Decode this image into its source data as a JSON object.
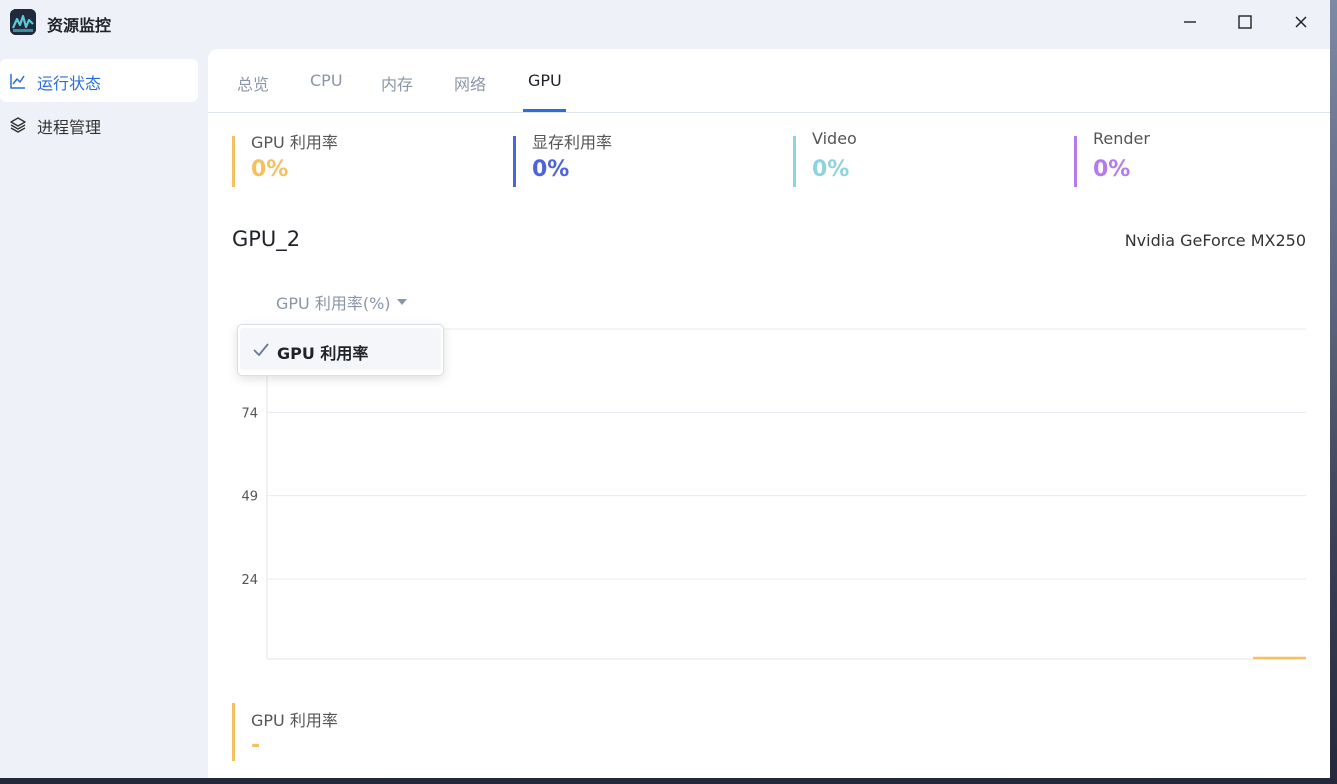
{
  "window": {
    "title": "资源监控",
    "controls": [
      "minimize-icon",
      "maximize-icon",
      "close-icon"
    ]
  },
  "sidebar": {
    "items": [
      {
        "label": "运行状态",
        "icon": "line-chart-icon",
        "active": true
      },
      {
        "label": "进程管理",
        "icon": "layers-icon",
        "active": false
      }
    ]
  },
  "tabs": [
    {
      "label": "总览"
    },
    {
      "label": "CPU"
    },
    {
      "label": "内存"
    },
    {
      "label": "网络"
    },
    {
      "label": "GPU",
      "active": true
    }
  ],
  "stats": [
    {
      "label": "GPU 利用率",
      "value": "0%",
      "color": "#f5c160"
    },
    {
      "label": "显存利用率",
      "value": "0%",
      "color": "#4e65d9"
    },
    {
      "label": "Video",
      "value": "0%",
      "color": "#8fd3df"
    },
    {
      "label": "Render",
      "value": "0%",
      "color": "#b57bea"
    }
  ],
  "gpu": {
    "name": "GPU_2",
    "model": "Nvidia GeForce MX250"
  },
  "metric_select": {
    "value": "GPU 利用率(%)"
  },
  "dropdown": {
    "options": [
      {
        "label": "GPU 利用率",
        "checked": true
      }
    ]
  },
  "chart_data": {
    "type": "line",
    "series": [
      {
        "name": "GPU 利用率",
        "color": "#f5c160",
        "values": [
          0,
          0
        ]
      }
    ],
    "y_ticks": [
      "74",
      "49",
      "24"
    ],
    "ylim": [
      0,
      99
    ],
    "grid": true
  },
  "legend": {
    "label": "GPU 利用率",
    "value": "-"
  },
  "colors": {
    "accent": "#2b6ed9",
    "series_gpu": "#f5c160"
  }
}
